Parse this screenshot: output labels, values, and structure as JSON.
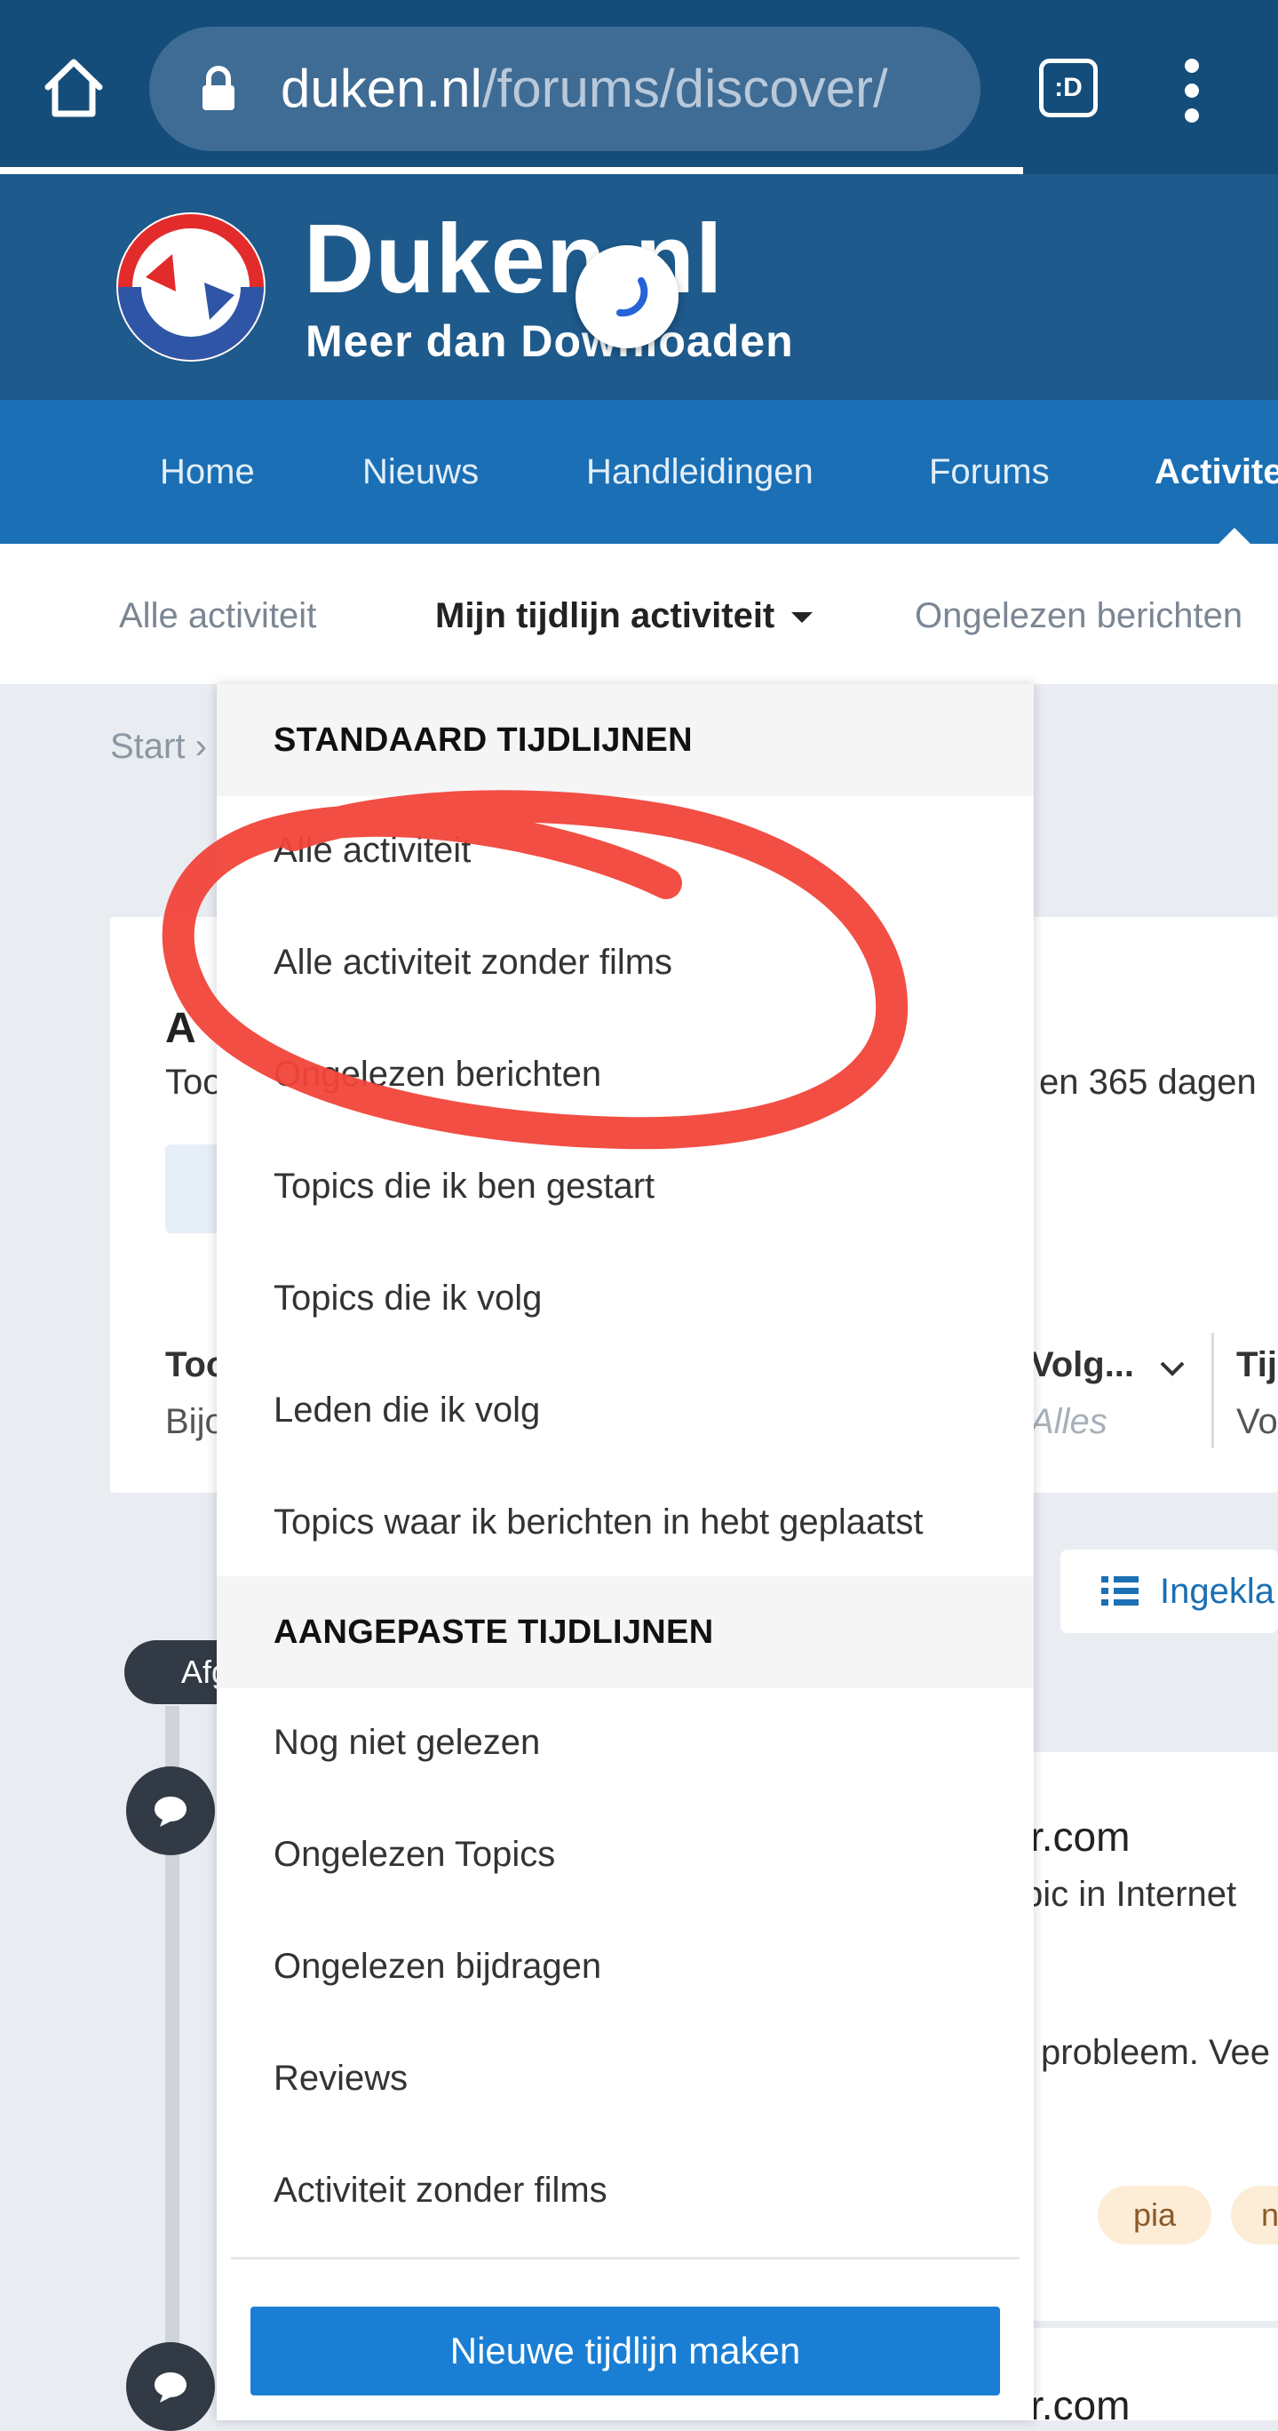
{
  "browser": {
    "url_host": "duken.nl",
    "url_path": "/forums/discover/",
    "tabs_label": ":D",
    "icons": [
      "home-icon",
      "lock-icon",
      "tabs-icon",
      "more-vert-icon"
    ]
  },
  "site": {
    "logo_title": "Duken.nl",
    "logo_subtitle": "Meer dan Downloaden",
    "logo_colors": [
      "#e32b2b",
      "#2f56a6"
    ]
  },
  "nav": {
    "items": [
      "Home",
      "Nieuws",
      "Handleidingen",
      "Forums",
      "Activite"
    ]
  },
  "subnav": {
    "items": [
      "Alle activiteit",
      "Mijn tijdlijn activiteit",
      "Ongelezen berichten"
    ]
  },
  "background": {
    "breadcrumb": "Start",
    "card_line": "Too",
    "card_right": "en 365 dagen",
    "filter_left_title": "Too",
    "filter_left_sub": "Bijo",
    "filter_follow_title": "Volg...",
    "filter_follow_sub": "Alles",
    "filter_right_title": "Tij",
    "filter_right_sub": "Vo",
    "view_button": "Ingekla",
    "timeline_pill": "Afg",
    "item1_title": "r.com",
    "item1_meta": "pic in Internet",
    "item1_excerpt": "probleem. Vee",
    "tag1": "pia",
    "tag2": "n",
    "item2_title": "r.com"
  },
  "menu": {
    "section1": "STANDAARD TIJDLIJNEN",
    "standard": [
      "Alle activiteit",
      "Alle activiteit zonder films",
      "Ongelezen berichten",
      "Topics die ik ben gestart",
      "Topics die ik volg",
      "Leden die ik volg",
      "Topics waar ik berichten in hebt geplaatst"
    ],
    "section2": "AANGEPASTE TIJDLIJNEN",
    "custom": [
      "Nog niet gelezen",
      "Ongelezen Topics",
      "Ongelezen bijdragen",
      "Reviews",
      "Activiteit zonder films"
    ],
    "new_button": "Nieuwe tijdlijn maken"
  },
  "colors": {
    "browser_bar": "#144d79",
    "header": "#1e5a8c",
    "nav": "#1a6fb5",
    "primary_button": "#1a7fd4",
    "annotation": "#f1453a"
  }
}
